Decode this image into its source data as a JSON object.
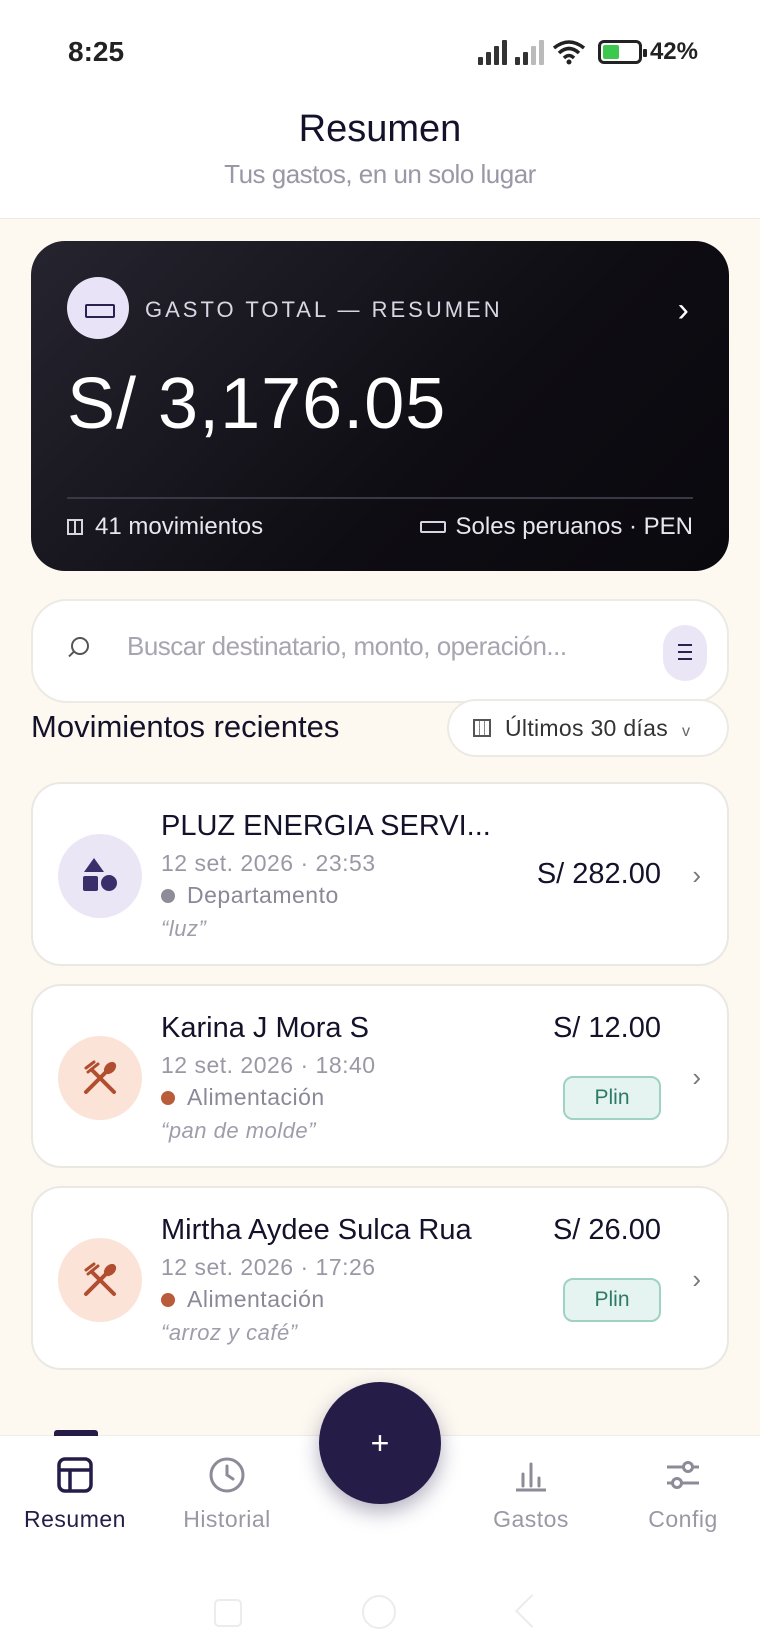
{
  "status": {
    "time": "8:25",
    "battery": "42%"
  },
  "header": {
    "title": "Resumen",
    "subtitle": "Tus gastos, en un solo lugar"
  },
  "total_card": {
    "label": "GASTO TOTAL — RESUMEN",
    "amount": "S/ 3,176.05",
    "movements": "41 movimientos",
    "currency": "Soles peruanos · PEN"
  },
  "search": {
    "placeholder": "Buscar destinatario, monto, operación..."
  },
  "recent": {
    "title": "Movimientos recientes",
    "range": "Últimos 30 días"
  },
  "transactions": [
    {
      "name": "PLUZ ENERGIA SERVI...",
      "date": "12 set. 2026 · 23:53",
      "category": "Departamento",
      "category_color": "#8e8c96",
      "note": "“luz”",
      "amount": "S/ 282.00",
      "badge": "",
      "icon": "shapes-icon"
    },
    {
      "name": "Karina J Mora S",
      "date": "12 set. 2026 · 18:40",
      "category": "Alimentación",
      "category_color": "#b85c3c",
      "note": "“pan de molde”",
      "amount": "S/ 12.00",
      "badge": "Plin",
      "icon": "utensils-icon"
    },
    {
      "name": "Mirtha Aydee Sulca Rua",
      "date": "12 set. 2026 · 17:26",
      "category": "Alimentación",
      "category_color": "#b85c3c",
      "note": "“arroz y café”",
      "amount": "S/ 26.00",
      "badge": "Plin",
      "icon": "utensils-icon"
    }
  ],
  "fab": {
    "label": "+"
  },
  "nav": [
    {
      "label": "Resumen",
      "icon": "dashboard-icon"
    },
    {
      "label": "Historial",
      "icon": "clock-icon"
    },
    {
      "label": "Gastos",
      "icon": "bar-chart-icon"
    },
    {
      "label": "Config",
      "icon": "sliders-icon"
    }
  ]
}
